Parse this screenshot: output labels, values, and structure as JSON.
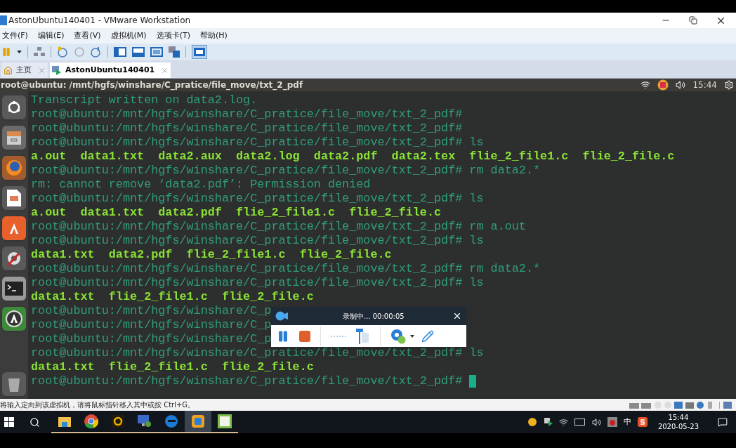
{
  "window": {
    "title": "AstonUbuntu140401 - VMware Workstation"
  },
  "menu": [
    "文件(F)",
    "编辑(E)",
    "查看(V)",
    "虚拟机(M)",
    "选项卡(T)",
    "帮助(H)"
  ],
  "tabs": [
    {
      "label": "主页",
      "selected": false
    },
    {
      "label": "AstonUbuntu140401",
      "selected": true
    }
  ],
  "ubuntu_panel": {
    "title": "root@ubuntu: /mnt/hgfs/winshare/C_pratice/file_move/txt_2_pdf",
    "clock": "15:44"
  },
  "terminal": {
    "lines": [
      {
        "kind": "text",
        "text": "Transcript written on data2.log."
      },
      {
        "kind": "text",
        "text": "root@ubuntu:/mnt/hgfs/winshare/C_pratice/file_move/txt_2_pdf#"
      },
      {
        "kind": "text",
        "text": "root@ubuntu:/mnt/hgfs/winshare/C_pratice/file_move/txt_2_pdf#"
      },
      {
        "kind": "text",
        "text": "root@ubuntu:/mnt/hgfs/winshare/C_pratice/file_move/txt_2_pdf# ls"
      },
      {
        "kind": "listing",
        "text": "a.out  data1.txt  data2.aux  data2.log  data2.pdf  data2.tex  flie_2_file1.c  flie_2_file.c"
      },
      {
        "kind": "text",
        "text": "root@ubuntu:/mnt/hgfs/winshare/C_pratice/file_move/txt_2_pdf# rm data2.*"
      },
      {
        "kind": "text",
        "text": "rm: cannot remove ‘data2.pdf’: Permission denied"
      },
      {
        "kind": "text",
        "text": "root@ubuntu:/mnt/hgfs/winshare/C_pratice/file_move/txt_2_pdf# ls"
      },
      {
        "kind": "listing",
        "text": "a.out  data1.txt  data2.pdf  flie_2_file1.c  flie_2_file.c"
      },
      {
        "kind": "text",
        "text": "root@ubuntu:/mnt/hgfs/winshare/C_pratice/file_move/txt_2_pdf# rm a.out"
      },
      {
        "kind": "text",
        "text": "root@ubuntu:/mnt/hgfs/winshare/C_pratice/file_move/txt_2_pdf# ls"
      },
      {
        "kind": "listing",
        "text": "data1.txt  data2.pdf  flie_2_file1.c  flie_2_file.c"
      },
      {
        "kind": "text",
        "text": "root@ubuntu:/mnt/hgfs/winshare/C_pratice/file_move/txt_2_pdf# rm data2.*"
      },
      {
        "kind": "text",
        "text": "root@ubuntu:/mnt/hgfs/winshare/C_pratice/file_move/txt_2_pdf# ls"
      },
      {
        "kind": "listing",
        "text": "data1.txt  flie_2_file1.c  flie_2_file.c"
      },
      {
        "kind": "text",
        "text": "root@ubuntu:/mnt/hgfs/winshare/C_p"
      },
      {
        "kind": "text",
        "text": "root@ubuntu:/mnt/hgfs/winshare/C_p"
      },
      {
        "kind": "text",
        "text": "root@ubuntu:/mnt/hgfs/winshare/C_p"
      },
      {
        "kind": "text",
        "text": "root@ubuntu:/mnt/hgfs/winshare/C_pratice/file_move/txt_2_pdf# ls"
      },
      {
        "kind": "listing",
        "text": "data1.txt  flie_2_file1.c  flie_2_file.c"
      },
      {
        "kind": "text",
        "text": "root@ubuntu:/mnt/hgfs/winshare/C_pratice/file_move/txt_2_pdf# "
      }
    ]
  },
  "recorder": {
    "status": "录制中... 00:00:05"
  },
  "status_bar": {
    "message": "将输入定向到该虚拟机，请将鼠标指针移入其中或按 Ctrl+G。"
  },
  "taskbar": {
    "apps": [
      {
        "kind": "folder",
        "selected": false
      },
      {
        "kind": "chrome",
        "selected": false
      },
      {
        "kind": "g",
        "selected": false
      },
      {
        "kind": "remote",
        "selected": false
      },
      {
        "kind": "edge",
        "selected": false
      },
      {
        "kind": "vmware",
        "selected": true
      },
      {
        "kind": "notepad",
        "selected": false
      }
    ],
    "ime": "中",
    "time": "15:44",
    "date": "2020-05-23"
  }
}
